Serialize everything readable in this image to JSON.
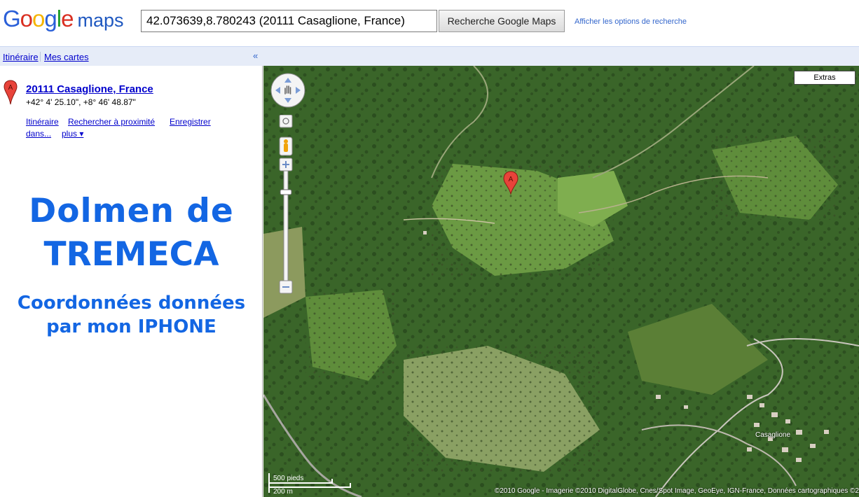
{
  "header": {
    "logo_text": "Google",
    "logo_maps": "maps",
    "search_value": "42.073639,8.780243 (20111 Casaglione, France)",
    "search_button": "Recherche Google Maps",
    "search_options": "Afficher les options de recherche"
  },
  "linkbar": {
    "itinerary": "Itinéraire",
    "my_maps": "Mes cartes",
    "collapse": "«"
  },
  "result": {
    "marker_letter": "A",
    "title": "20111 Casaglione, France",
    "coords": "+42° 4' 25.10\", +8° 46' 48.87\"",
    "actions": {
      "itinerary": "Itinéraire",
      "nearby": "Rechercher à proximité",
      "save_line1": "Enregistrer",
      "save_line2": "dans...",
      "more": "plus ▾"
    }
  },
  "promo": {
    "line1": "Dolmen de",
    "line2": "TREMECA",
    "line3": "Coordonnées données",
    "line4": "par mon IPHONE"
  },
  "map": {
    "extras": "Extras",
    "marker_letter": "A",
    "scale_feet": "500 pieds",
    "scale_meters": "200 m",
    "village": "Casaglione",
    "copyright": "©2010 Google - Imagerie ©2010 DigitalGlobe, Cnes/Spot Image, GeoEye, IGN-France, Données cartographiques ©2"
  },
  "colors": {
    "link": "#0000cc",
    "promo": "#1366e3",
    "marker": "#e8433a",
    "linkbar_bg": "#e6ecf8"
  }
}
